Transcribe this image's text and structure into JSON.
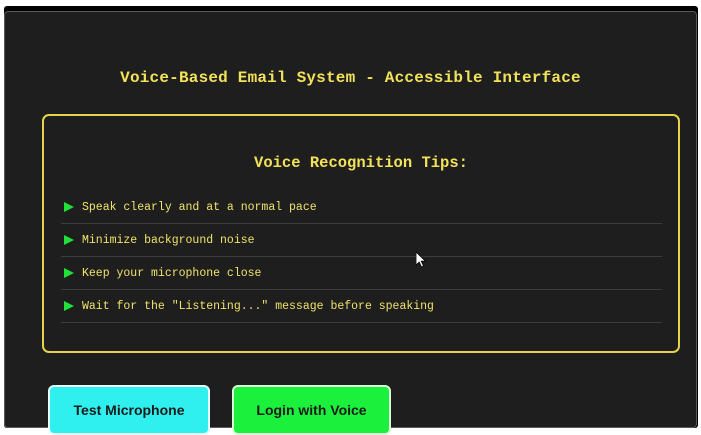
{
  "app": {
    "title": "Voice-Based Email System - Accessible Interface"
  },
  "tips": {
    "heading": "Voice Recognition Tips:",
    "items": [
      "Speak clearly and at a normal pace",
      "Minimize background noise",
      "Keep your microphone close",
      "Wait for the \"Listening...\" message before speaking"
    ]
  },
  "actions": {
    "test_microphone": "Test Microphone",
    "login_with_voice": "Login with Voice"
  },
  "icons": {
    "tip_bullet": "play-triangle-icon",
    "pointer": "mouse-cursor-icon"
  },
  "colors": {
    "background": "#1e1e1e",
    "accent_yellow": "#f2e25a",
    "bullet_green": "#22e03a",
    "test_button": "#2ff0ef",
    "login_button": "#1bf03c"
  }
}
